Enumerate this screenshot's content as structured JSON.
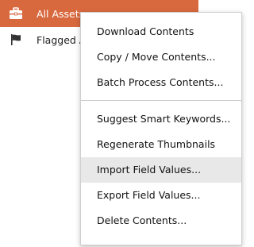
{
  "sidebar": {
    "items": [
      {
        "label": "All Assets",
        "icon": "briefcase-icon",
        "selected": true
      },
      {
        "label": "Flagged Assets",
        "icon": "flag-icon",
        "selected": false
      }
    ]
  },
  "context_menu": {
    "groups": [
      [
        "Download Contents",
        "Copy / Move Contents...",
        "Batch Process Contents..."
      ],
      [
        "Suggest Smart Keywords...",
        "Regenerate Thumbnails",
        "Import Field Values...",
        "Export Field Values...",
        "Delete Contents..."
      ]
    ],
    "highlighted_item": "Import Field Values..."
  },
  "colors": {
    "selected_row": "#d8693f",
    "menu_highlight": "#e8e8e8"
  }
}
